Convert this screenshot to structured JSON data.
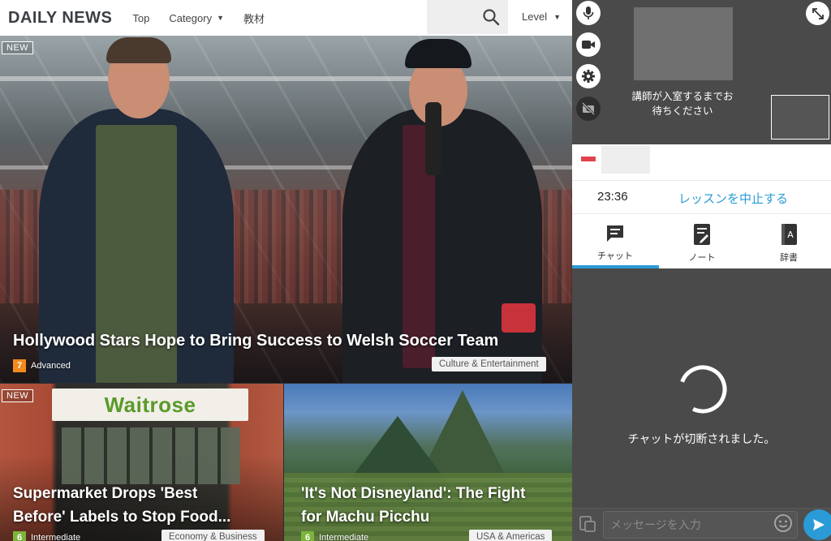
{
  "nav": {
    "brand": "DAILY NEWS",
    "links": [
      "Top",
      "Category",
      "教材"
    ],
    "level": "Level",
    "search_icon": "search-icon"
  },
  "articles": {
    "main": {
      "badge": "NEW",
      "title": "Hollywood Stars Hope to Bring Success to Welsh Soccer Team",
      "level_num": "7",
      "level_label": "Advanced",
      "level_color": "#f28a1c",
      "category": "Culture & Entertainment"
    },
    "bottom_left": {
      "badge": "NEW",
      "sign_text": "Waitrose",
      "title_line1": "Supermarket Drops 'Best",
      "title_line2": "Before' Labels to Stop Food...",
      "level_num": "6",
      "level_label": "Intermediate",
      "level_color": "#7cb53a",
      "category": "Economy & Business"
    },
    "bottom_right": {
      "title_line1": "'It's Not Disneyland': The Fight",
      "title_line2": "for Machu Picchu",
      "level_num": "6",
      "level_label": "Intermediate",
      "level_color": "#7cb53a",
      "category": "USA & Americas"
    }
  },
  "video": {
    "waiting_line1": "講師が入室するまでお",
    "waiting_line2": "待ちください",
    "buttons": [
      "mic-icon",
      "video-camera-icon",
      "gear-icon",
      "camera-off-icon"
    ],
    "expand_icon": "expand-icon"
  },
  "lesson": {
    "timer": "23:36",
    "stop_label": "レッスンを中止する",
    "flag_color": "#e0434f"
  },
  "tabs": [
    {
      "label": "チャット",
      "icon": "chat-icon",
      "active": true
    },
    {
      "label": "ノート",
      "icon": "note-icon",
      "active": false
    },
    {
      "label": "辞書",
      "icon": "dictionary-icon",
      "active": false
    }
  ],
  "chat": {
    "status": "チャットが切断されました。",
    "placeholder": "メッセージを入力",
    "accent": "#2a9bd6"
  }
}
